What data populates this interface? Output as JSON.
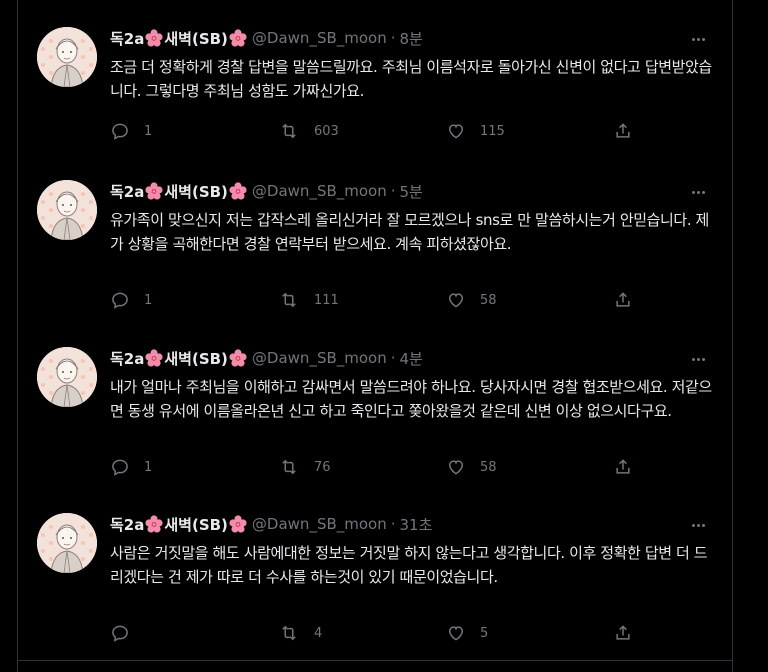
{
  "colors": {
    "background": "#000000",
    "text": "#e7e9ea",
    "muted": "#71767b",
    "border": "#2f3336"
  },
  "author": {
    "display_name_prefix": "독2a",
    "display_name_middle": "새벽(SB)",
    "handle": "@Dawn_SB_moon",
    "flower_icon": "hibiscus-emoji"
  },
  "tweets": [
    {
      "time": "8분",
      "text": "조금 더 정확하게 경찰 답변을 말씀드릴까요. 주최님 이름석자로 돌아가신 신변이 없다고 답변받았습니다. 그렇다명 주최님 성함도 가짜신가요.",
      "replies": "1",
      "retweets": "603",
      "likes": "115"
    },
    {
      "time": "5분",
      "text": "유가족이 맞으신지 저는 갑작스레 올리신거라 잘 모르겠으나 sns로 만 말씀하시는거 안믿습니다. 제가 상황을 곡해한다면 경찰 연락부터 받으세요. 계속 피하셨잖아요.",
      "replies": "1",
      "retweets": "111",
      "likes": "58"
    },
    {
      "time": "4분",
      "text": "내가 얼마나 주최님을 이해하고 감싸면서 말씀드려야 하나요. 당사자시면 경찰 협조받으세요. 저같으면 동생 유서에 이름올라온년 신고 하고 죽인다고 쫒아왔을것 같은데 신변 이상 없으시다구요.",
      "replies": "1",
      "retweets": "76",
      "likes": "58"
    },
    {
      "time": "31초",
      "text": "사람은 거짓말을 해도 사람에대한 정보는 거짓말 하지 않는다고 생각합니다. 이후 정확한 답변 더 드리겠다는 건 제가 따로 더 수사를 하는것이 있기 때문이었습니다.",
      "replies": "",
      "retweets": "4",
      "likes": "5"
    }
  ]
}
